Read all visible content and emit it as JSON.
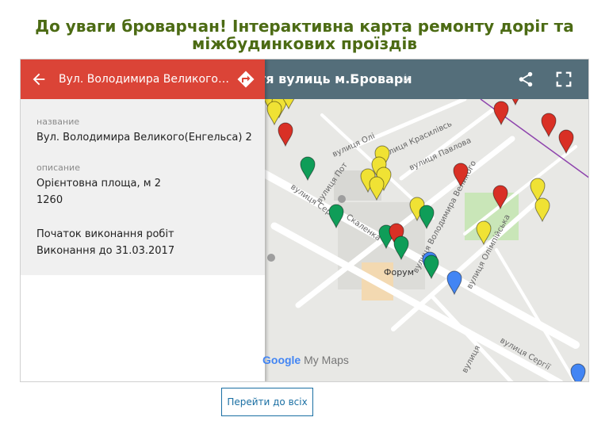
{
  "page": {
    "title_line1": "До уваги броварчан! Інтерактивна карта ремонту доріг та",
    "title_line2": "міжбудинкових проїздів"
  },
  "map": {
    "header_title": "тя вулиць м.Бровари",
    "brand_color": "#546e7a",
    "google_brand": "Google",
    "mymaps_label": "My Maps",
    "street_labels": [
      "вулиця Олі",
      "вулиця Красилівсь",
      "вулиця Пот",
      "вулиця Павлова",
      "вулиця Сергі",
      "Скаленка",
      "вулиця Володимира Великого",
      "вулиця Олімпійська",
      "Форум",
      "вулиця Сергії",
      "вулиця"
    ]
  },
  "panel": {
    "header_title": "Вул. Володимира Великого(Енгельса) 2",
    "header_color": "#db4437",
    "name_label": "название",
    "name_value": "Вул. Володимира Великого(Енгельса) 2",
    "desc_label": "описание",
    "desc_line1": "Орієнтовна площа, м 2",
    "desc_line2": "1260",
    "desc_line3": "Початок виконання робіт",
    "desc_line4": "Виконання до 31.03.2017"
  },
  "markers": [
    {
      "color": "yellow"
    },
    {
      "color": "yellow"
    },
    {
      "color": "yellow"
    },
    {
      "color": "yellow"
    },
    {
      "color": "red"
    },
    {
      "color": "green"
    },
    {
      "color": "yellow"
    },
    {
      "color": "yellow"
    },
    {
      "color": "yellow"
    },
    {
      "color": "yellow"
    },
    {
      "color": "yellow"
    },
    {
      "color": "green"
    },
    {
      "color": "green"
    },
    {
      "color": "red"
    },
    {
      "color": "green"
    },
    {
      "color": "yellow"
    },
    {
      "color": "green"
    },
    {
      "color": "blue"
    },
    {
      "color": "green"
    },
    {
      "color": "blue"
    },
    {
      "color": "red"
    },
    {
      "color": "red"
    },
    {
      "color": "yellow"
    },
    {
      "color": "yellow"
    },
    {
      "color": "yellow"
    },
    {
      "color": "red"
    },
    {
      "color": "red"
    },
    {
      "color": "red"
    },
    {
      "color": "red"
    },
    {
      "color": "blue"
    }
  ],
  "colors": {
    "yellow": "#f0e234",
    "red": "#d93025",
    "green": "#0f9d58",
    "blue": "#4285f4"
  },
  "button": {
    "goto_label": "Перейти до всіх"
  }
}
